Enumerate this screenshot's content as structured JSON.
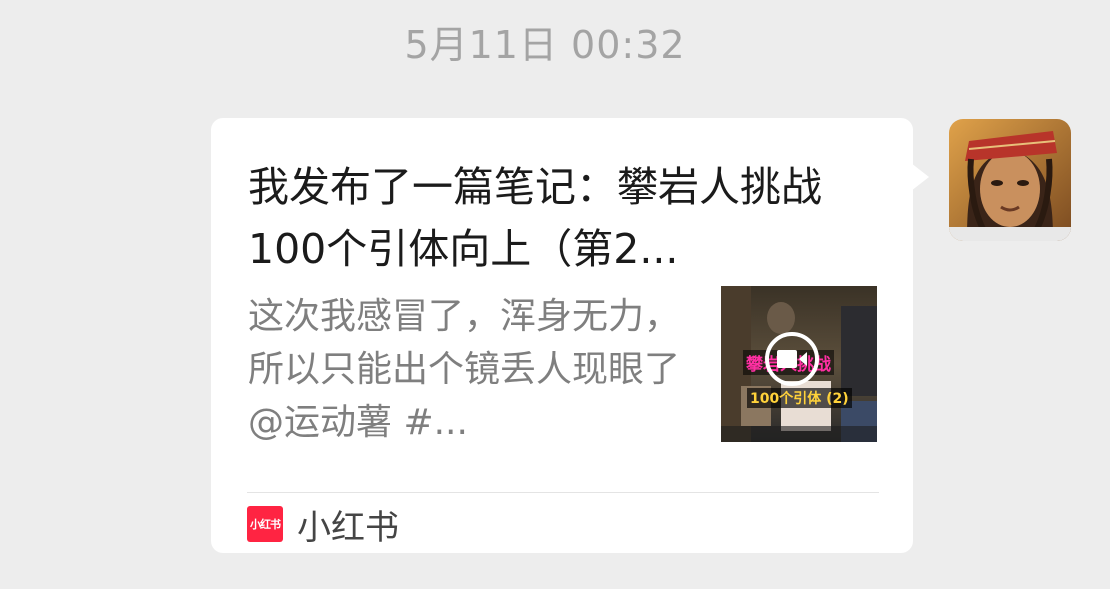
{
  "chat": {
    "timestamp": "5月11日 00:32"
  },
  "message": {
    "sender_avatar": "avatar-icon",
    "card": {
      "title": "我发布了一篇笔记：攀岩人挑战 100个引体向上（第2...",
      "description": "这次我感冒了，浑身无力，所以只能出个镜丢人现眼了 @运动薯 #...",
      "thumbnail": {
        "overlay_title": "攀岩人挑战",
        "overlay_subtitle": "100个引体 (2)",
        "icon": "video-camera-icon"
      },
      "source": {
        "logo_text": "小红书",
        "name": "小红书",
        "brand_color": "#ff2442"
      }
    }
  }
}
